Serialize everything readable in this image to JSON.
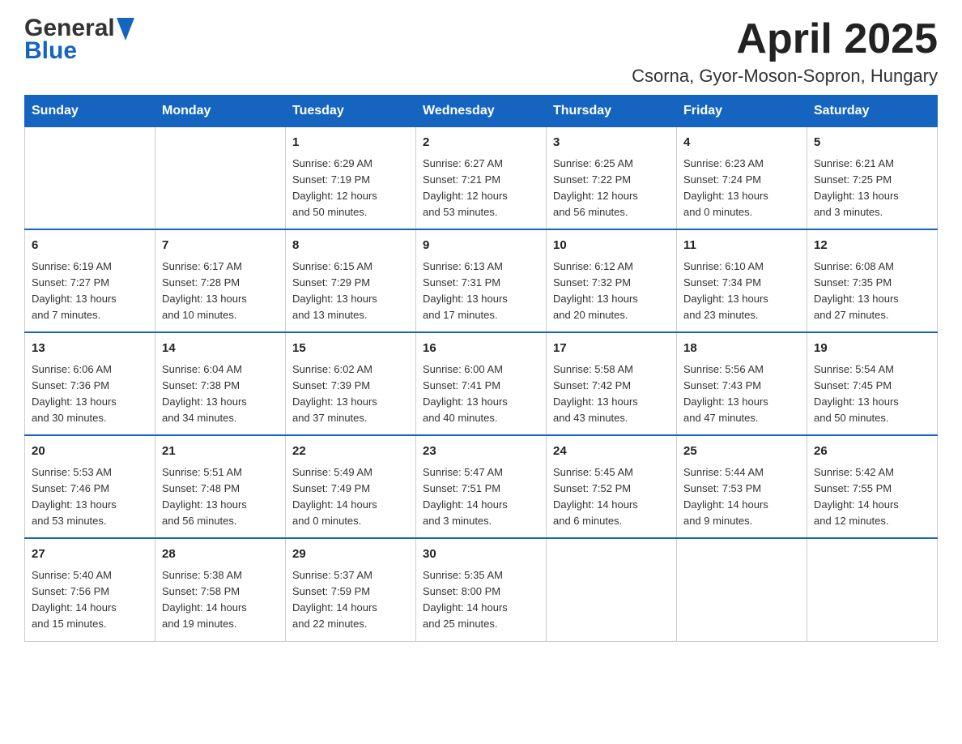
{
  "logo": {
    "line1": "General",
    "line2": "Blue"
  },
  "title": "April 2025",
  "subtitle": "Csorna, Gyor-Moson-Sopron, Hungary",
  "calendar": {
    "headers": [
      "Sunday",
      "Monday",
      "Tuesday",
      "Wednesday",
      "Thursday",
      "Friday",
      "Saturday"
    ],
    "weeks": [
      [
        {
          "day": "",
          "info": ""
        },
        {
          "day": "",
          "info": ""
        },
        {
          "day": "1",
          "info": "Sunrise: 6:29 AM\nSunset: 7:19 PM\nDaylight: 12 hours\nand 50 minutes."
        },
        {
          "day": "2",
          "info": "Sunrise: 6:27 AM\nSunset: 7:21 PM\nDaylight: 12 hours\nand 53 minutes."
        },
        {
          "day": "3",
          "info": "Sunrise: 6:25 AM\nSunset: 7:22 PM\nDaylight: 12 hours\nand 56 minutes."
        },
        {
          "day": "4",
          "info": "Sunrise: 6:23 AM\nSunset: 7:24 PM\nDaylight: 13 hours\nand 0 minutes."
        },
        {
          "day": "5",
          "info": "Sunrise: 6:21 AM\nSunset: 7:25 PM\nDaylight: 13 hours\nand 3 minutes."
        }
      ],
      [
        {
          "day": "6",
          "info": "Sunrise: 6:19 AM\nSunset: 7:27 PM\nDaylight: 13 hours\nand 7 minutes."
        },
        {
          "day": "7",
          "info": "Sunrise: 6:17 AM\nSunset: 7:28 PM\nDaylight: 13 hours\nand 10 minutes."
        },
        {
          "day": "8",
          "info": "Sunrise: 6:15 AM\nSunset: 7:29 PM\nDaylight: 13 hours\nand 13 minutes."
        },
        {
          "day": "9",
          "info": "Sunrise: 6:13 AM\nSunset: 7:31 PM\nDaylight: 13 hours\nand 17 minutes."
        },
        {
          "day": "10",
          "info": "Sunrise: 6:12 AM\nSunset: 7:32 PM\nDaylight: 13 hours\nand 20 minutes."
        },
        {
          "day": "11",
          "info": "Sunrise: 6:10 AM\nSunset: 7:34 PM\nDaylight: 13 hours\nand 23 minutes."
        },
        {
          "day": "12",
          "info": "Sunrise: 6:08 AM\nSunset: 7:35 PM\nDaylight: 13 hours\nand 27 minutes."
        }
      ],
      [
        {
          "day": "13",
          "info": "Sunrise: 6:06 AM\nSunset: 7:36 PM\nDaylight: 13 hours\nand 30 minutes."
        },
        {
          "day": "14",
          "info": "Sunrise: 6:04 AM\nSunset: 7:38 PM\nDaylight: 13 hours\nand 34 minutes."
        },
        {
          "day": "15",
          "info": "Sunrise: 6:02 AM\nSunset: 7:39 PM\nDaylight: 13 hours\nand 37 minutes."
        },
        {
          "day": "16",
          "info": "Sunrise: 6:00 AM\nSunset: 7:41 PM\nDaylight: 13 hours\nand 40 minutes."
        },
        {
          "day": "17",
          "info": "Sunrise: 5:58 AM\nSunset: 7:42 PM\nDaylight: 13 hours\nand 43 minutes."
        },
        {
          "day": "18",
          "info": "Sunrise: 5:56 AM\nSunset: 7:43 PM\nDaylight: 13 hours\nand 47 minutes."
        },
        {
          "day": "19",
          "info": "Sunrise: 5:54 AM\nSunset: 7:45 PM\nDaylight: 13 hours\nand 50 minutes."
        }
      ],
      [
        {
          "day": "20",
          "info": "Sunrise: 5:53 AM\nSunset: 7:46 PM\nDaylight: 13 hours\nand 53 minutes."
        },
        {
          "day": "21",
          "info": "Sunrise: 5:51 AM\nSunset: 7:48 PM\nDaylight: 13 hours\nand 56 minutes."
        },
        {
          "day": "22",
          "info": "Sunrise: 5:49 AM\nSunset: 7:49 PM\nDaylight: 14 hours\nand 0 minutes."
        },
        {
          "day": "23",
          "info": "Sunrise: 5:47 AM\nSunset: 7:51 PM\nDaylight: 14 hours\nand 3 minutes."
        },
        {
          "day": "24",
          "info": "Sunrise: 5:45 AM\nSunset: 7:52 PM\nDaylight: 14 hours\nand 6 minutes."
        },
        {
          "day": "25",
          "info": "Sunrise: 5:44 AM\nSunset: 7:53 PM\nDaylight: 14 hours\nand 9 minutes."
        },
        {
          "day": "26",
          "info": "Sunrise: 5:42 AM\nSunset: 7:55 PM\nDaylight: 14 hours\nand 12 minutes."
        }
      ],
      [
        {
          "day": "27",
          "info": "Sunrise: 5:40 AM\nSunset: 7:56 PM\nDaylight: 14 hours\nand 15 minutes."
        },
        {
          "day": "28",
          "info": "Sunrise: 5:38 AM\nSunset: 7:58 PM\nDaylight: 14 hours\nand 19 minutes."
        },
        {
          "day": "29",
          "info": "Sunrise: 5:37 AM\nSunset: 7:59 PM\nDaylight: 14 hours\nand 22 minutes."
        },
        {
          "day": "30",
          "info": "Sunrise: 5:35 AM\nSunset: 8:00 PM\nDaylight: 14 hours\nand 25 minutes."
        },
        {
          "day": "",
          "info": ""
        },
        {
          "day": "",
          "info": ""
        },
        {
          "day": "",
          "info": ""
        }
      ]
    ]
  }
}
